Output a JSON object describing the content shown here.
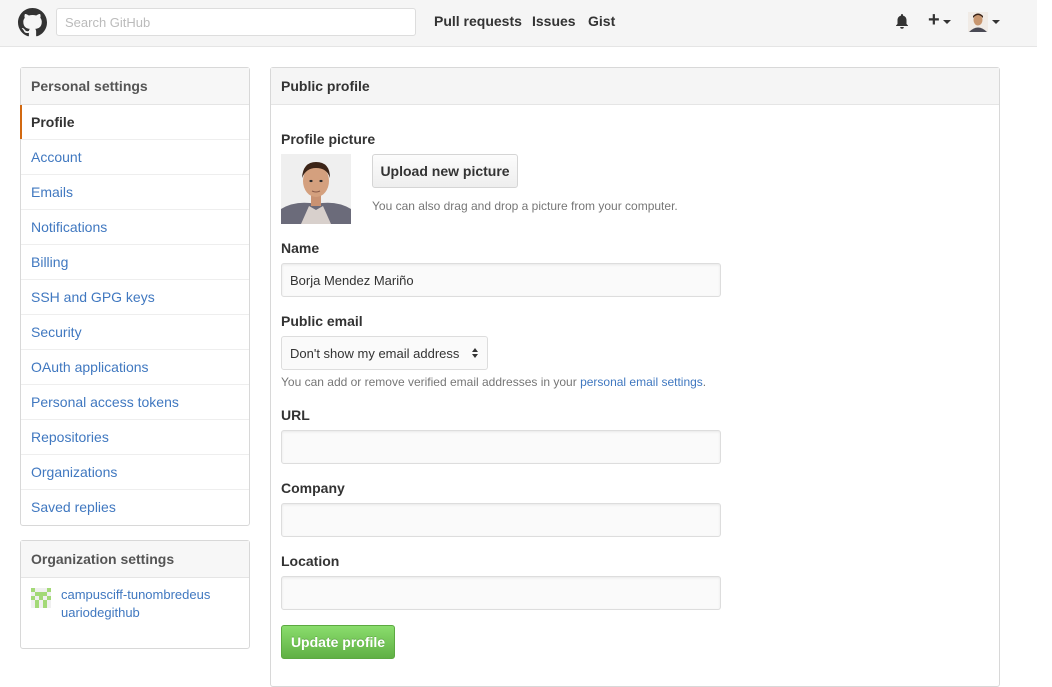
{
  "header": {
    "search_placeholder": "Search GitHub",
    "nav": [
      "Pull requests",
      "Issues",
      "Gist"
    ]
  },
  "sidebar": {
    "personal_heading": "Personal settings",
    "items": [
      {
        "label": "Profile",
        "selected": true
      },
      {
        "label": "Account"
      },
      {
        "label": "Emails"
      },
      {
        "label": "Notifications"
      },
      {
        "label": "Billing"
      },
      {
        "label": "SSH and GPG keys"
      },
      {
        "label": "Security"
      },
      {
        "label": "OAuth applications"
      },
      {
        "label": "Personal access tokens"
      },
      {
        "label": "Repositories"
      },
      {
        "label": "Organizations"
      },
      {
        "label": "Saved replies"
      }
    ],
    "org_heading": "Organization settings",
    "org_name": "campusciff-tunombredeusuariodegithub"
  },
  "profile": {
    "title": "Public profile",
    "picture_label": "Profile picture",
    "upload_button": "Upload new picture",
    "drag_note": "You can also drag and drop a picture from your computer.",
    "name_label": "Name",
    "name_value": "Borja Mendez Mariño",
    "email_label": "Public email",
    "email_value": "Don't show my email address",
    "email_note_pre": "You can add or remove verified email addresses in your ",
    "email_note_link": "personal email settings",
    "email_note_post": ".",
    "url_label": "URL",
    "url_value": "",
    "company_label": "Company",
    "company_value": "",
    "location_label": "Location",
    "location_value": "",
    "update_button": "Update profile"
  },
  "colors": {
    "link": "#4078c0",
    "selected_accent": "#d26911",
    "primary_button": "#60b044"
  }
}
